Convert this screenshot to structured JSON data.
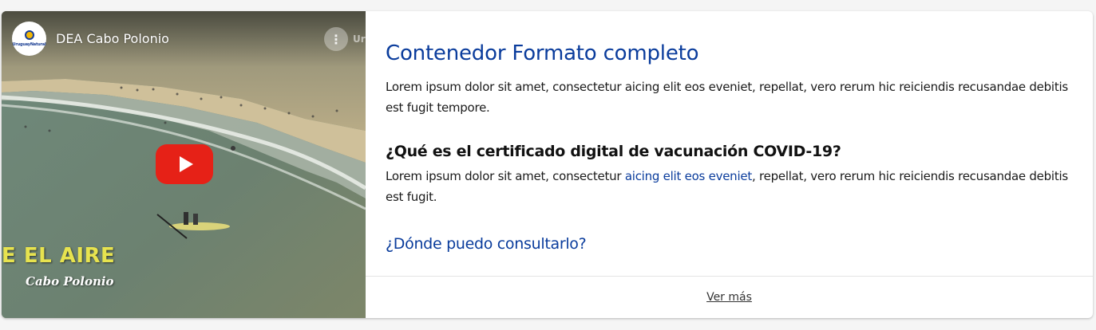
{
  "video": {
    "title": "DEA Cabo Polonio",
    "channel_logo_text": "UruguayNatural",
    "watermark_text": "Ur",
    "overlay_title": "E EL AIRE",
    "overlay_subtitle": "Cabo Polonio",
    "play_icon": "youtube-play-icon",
    "colors": {
      "play_button": "#e62117",
      "overlay_title": "#e7e34f"
    }
  },
  "content": {
    "title": "Contenedor Formato completo",
    "intro": "Lorem ipsum dolor sit amet, consectetur aicing elit eos eveniet, repellat, vero rerum hic reiciendis recusandae debitis est fugit tempore.",
    "question_heading": "¿Qué es el certificado digital de vacunación COVID-19?",
    "answer_before": "Lorem ipsum dolor sit amet, consectetur ",
    "answer_link": "aicing elit eos eveniet",
    "answer_after": ", repellat, vero rerum hic reiciendis recusandae debitis est fugit.",
    "where_link": "¿Dónde puedo consultarlo?",
    "colors": {
      "link": "#0a3c9c",
      "text": "#1a1a1a"
    }
  },
  "footer": {
    "more_label": "Ver más"
  }
}
